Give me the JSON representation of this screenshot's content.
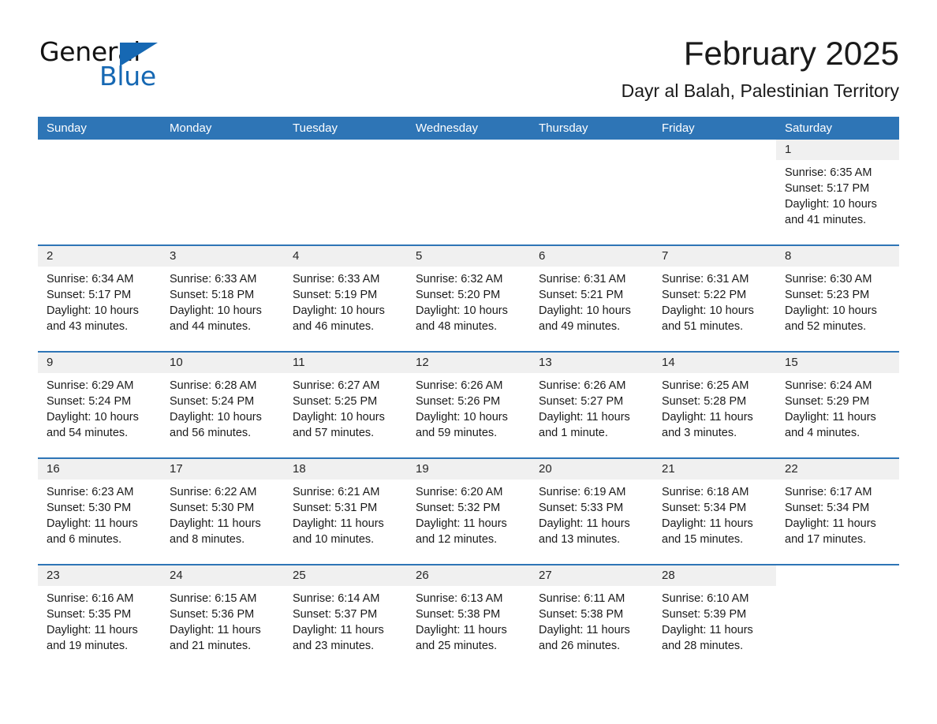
{
  "brand": {
    "name_part1": "General",
    "name_part2": "Blue",
    "accent_color": "#1668b3"
  },
  "header": {
    "title": "February 2025",
    "subtitle": "Dayr al Balah, Palestinian Territory"
  },
  "calendar": {
    "header_bg": "#2e75b6",
    "daynum_bg": "#f0f0f0",
    "weekdays": [
      "Sunday",
      "Monday",
      "Tuesday",
      "Wednesday",
      "Thursday",
      "Friday",
      "Saturday"
    ],
    "weeks": [
      [
        {
          "day": ""
        },
        {
          "day": ""
        },
        {
          "day": ""
        },
        {
          "day": ""
        },
        {
          "day": ""
        },
        {
          "day": ""
        },
        {
          "day": "1",
          "sunrise": "Sunrise: 6:35 AM",
          "sunset": "Sunset: 5:17 PM",
          "daylight": "Daylight: 10 hours and 41 minutes."
        }
      ],
      [
        {
          "day": "2",
          "sunrise": "Sunrise: 6:34 AM",
          "sunset": "Sunset: 5:17 PM",
          "daylight": "Daylight: 10 hours and 43 minutes."
        },
        {
          "day": "3",
          "sunrise": "Sunrise: 6:33 AM",
          "sunset": "Sunset: 5:18 PM",
          "daylight": "Daylight: 10 hours and 44 minutes."
        },
        {
          "day": "4",
          "sunrise": "Sunrise: 6:33 AM",
          "sunset": "Sunset: 5:19 PM",
          "daylight": "Daylight: 10 hours and 46 minutes."
        },
        {
          "day": "5",
          "sunrise": "Sunrise: 6:32 AM",
          "sunset": "Sunset: 5:20 PM",
          "daylight": "Daylight: 10 hours and 48 minutes."
        },
        {
          "day": "6",
          "sunrise": "Sunrise: 6:31 AM",
          "sunset": "Sunset: 5:21 PM",
          "daylight": "Daylight: 10 hours and 49 minutes."
        },
        {
          "day": "7",
          "sunrise": "Sunrise: 6:31 AM",
          "sunset": "Sunset: 5:22 PM",
          "daylight": "Daylight: 10 hours and 51 minutes."
        },
        {
          "day": "8",
          "sunrise": "Sunrise: 6:30 AM",
          "sunset": "Sunset: 5:23 PM",
          "daylight": "Daylight: 10 hours and 52 minutes."
        }
      ],
      [
        {
          "day": "9",
          "sunrise": "Sunrise: 6:29 AM",
          "sunset": "Sunset: 5:24 PM",
          "daylight": "Daylight: 10 hours and 54 minutes."
        },
        {
          "day": "10",
          "sunrise": "Sunrise: 6:28 AM",
          "sunset": "Sunset: 5:24 PM",
          "daylight": "Daylight: 10 hours and 56 minutes."
        },
        {
          "day": "11",
          "sunrise": "Sunrise: 6:27 AM",
          "sunset": "Sunset: 5:25 PM",
          "daylight": "Daylight: 10 hours and 57 minutes."
        },
        {
          "day": "12",
          "sunrise": "Sunrise: 6:26 AM",
          "sunset": "Sunset: 5:26 PM",
          "daylight": "Daylight: 10 hours and 59 minutes."
        },
        {
          "day": "13",
          "sunrise": "Sunrise: 6:26 AM",
          "sunset": "Sunset: 5:27 PM",
          "daylight": "Daylight: 11 hours and 1 minute."
        },
        {
          "day": "14",
          "sunrise": "Sunrise: 6:25 AM",
          "sunset": "Sunset: 5:28 PM",
          "daylight": "Daylight: 11 hours and 3 minutes."
        },
        {
          "day": "15",
          "sunrise": "Sunrise: 6:24 AM",
          "sunset": "Sunset: 5:29 PM",
          "daylight": "Daylight: 11 hours and 4 minutes."
        }
      ],
      [
        {
          "day": "16",
          "sunrise": "Sunrise: 6:23 AM",
          "sunset": "Sunset: 5:30 PM",
          "daylight": "Daylight: 11 hours and 6 minutes."
        },
        {
          "day": "17",
          "sunrise": "Sunrise: 6:22 AM",
          "sunset": "Sunset: 5:30 PM",
          "daylight": "Daylight: 11 hours and 8 minutes."
        },
        {
          "day": "18",
          "sunrise": "Sunrise: 6:21 AM",
          "sunset": "Sunset: 5:31 PM",
          "daylight": "Daylight: 11 hours and 10 minutes."
        },
        {
          "day": "19",
          "sunrise": "Sunrise: 6:20 AM",
          "sunset": "Sunset: 5:32 PM",
          "daylight": "Daylight: 11 hours and 12 minutes."
        },
        {
          "day": "20",
          "sunrise": "Sunrise: 6:19 AM",
          "sunset": "Sunset: 5:33 PM",
          "daylight": "Daylight: 11 hours and 13 minutes."
        },
        {
          "day": "21",
          "sunrise": "Sunrise: 6:18 AM",
          "sunset": "Sunset: 5:34 PM",
          "daylight": "Daylight: 11 hours and 15 minutes."
        },
        {
          "day": "22",
          "sunrise": "Sunrise: 6:17 AM",
          "sunset": "Sunset: 5:34 PM",
          "daylight": "Daylight: 11 hours and 17 minutes."
        }
      ],
      [
        {
          "day": "23",
          "sunrise": "Sunrise: 6:16 AM",
          "sunset": "Sunset: 5:35 PM",
          "daylight": "Daylight: 11 hours and 19 minutes."
        },
        {
          "day": "24",
          "sunrise": "Sunrise: 6:15 AM",
          "sunset": "Sunset: 5:36 PM",
          "daylight": "Daylight: 11 hours and 21 minutes."
        },
        {
          "day": "25",
          "sunrise": "Sunrise: 6:14 AM",
          "sunset": "Sunset: 5:37 PM",
          "daylight": "Daylight: 11 hours and 23 minutes."
        },
        {
          "day": "26",
          "sunrise": "Sunrise: 6:13 AM",
          "sunset": "Sunset: 5:38 PM",
          "daylight": "Daylight: 11 hours and 25 minutes."
        },
        {
          "day": "27",
          "sunrise": "Sunrise: 6:11 AM",
          "sunset": "Sunset: 5:38 PM",
          "daylight": "Daylight: 11 hours and 26 minutes."
        },
        {
          "day": "28",
          "sunrise": "Sunrise: 6:10 AM",
          "sunset": "Sunset: 5:39 PM",
          "daylight": "Daylight: 11 hours and 28 minutes."
        },
        {
          "day": ""
        }
      ]
    ]
  }
}
